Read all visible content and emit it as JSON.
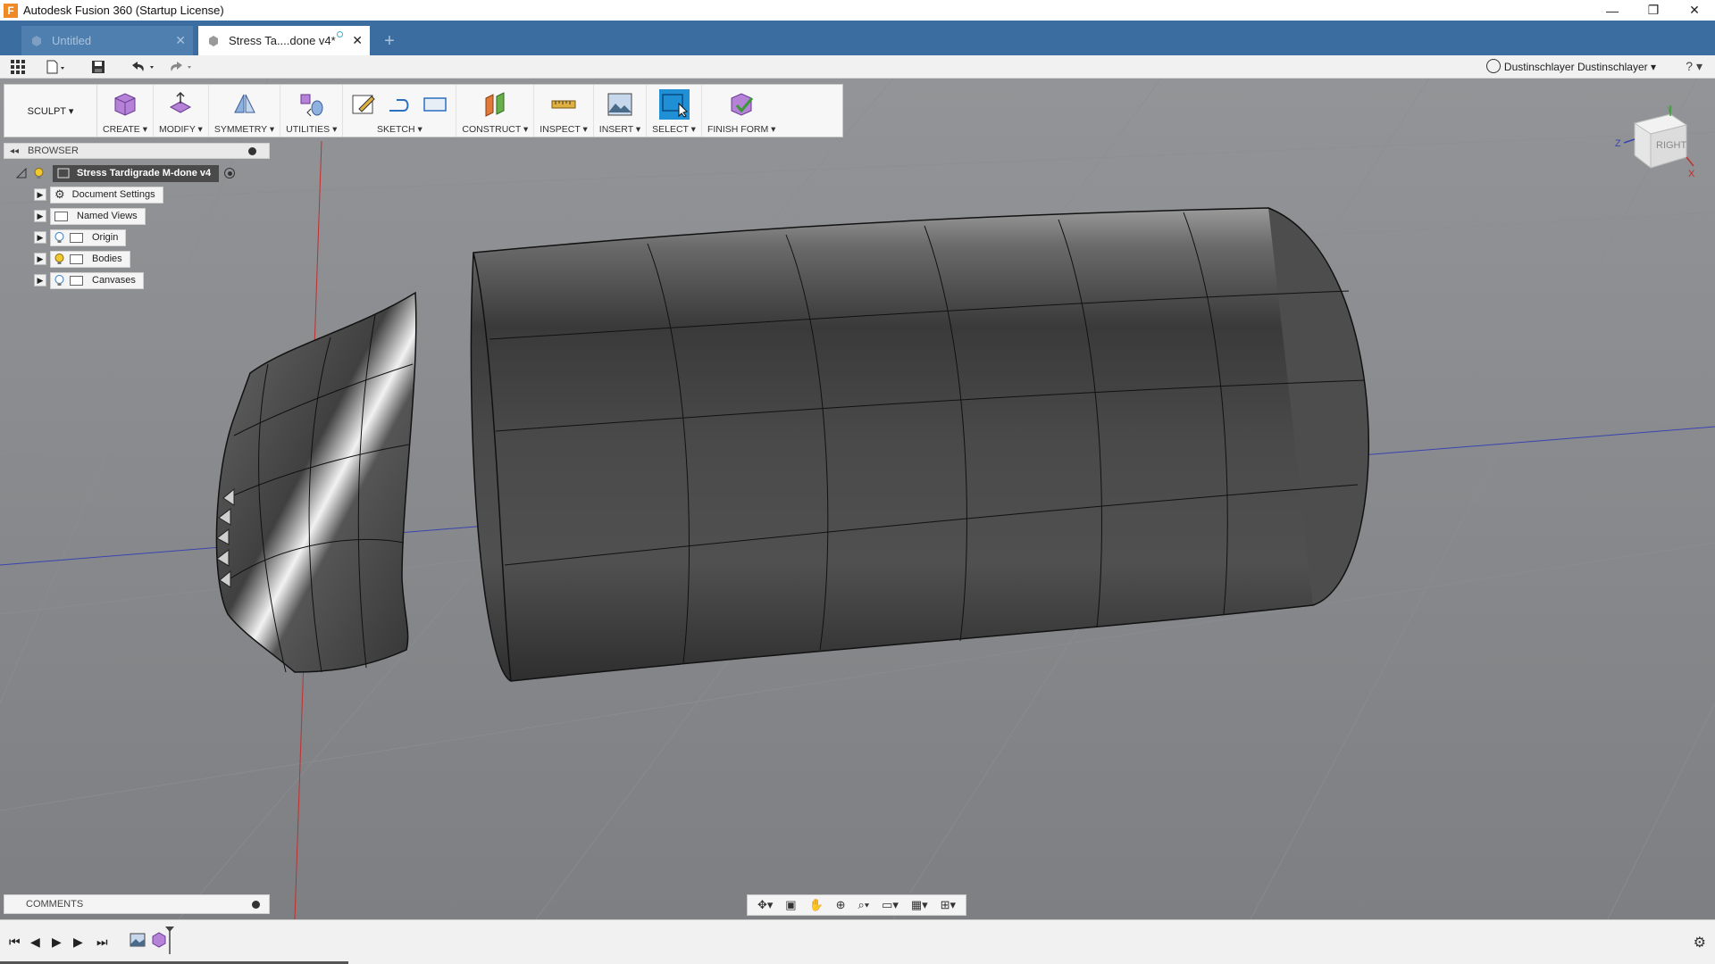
{
  "window": {
    "title": "Autodesk Fusion 360 (Startup License)",
    "app_icon": "F",
    "minimize": "—",
    "maximize": "❐",
    "close": "✕"
  },
  "tabs": [
    {
      "label": "Untitled",
      "active": false,
      "close": "✕"
    },
    {
      "label": "Stress Ta....done v4*",
      "active": true,
      "close": "✕"
    }
  ],
  "new_tab": "+",
  "qab": {
    "user": "Dustinschlayer Dustinschlayer ▾",
    "help": "? ▾"
  },
  "toolbar": {
    "workspace": "SCULPT ▾",
    "groups": {
      "create": "CREATE ▾",
      "modify": "MODIFY ▾",
      "symmetry": "SYMMETRY ▾",
      "utilities": "UTILITIES ▾",
      "sketch": "SKETCH ▾",
      "construct": "CONSTRUCT ▾",
      "inspect": "INSPECT ▾",
      "insert": "INSERT ▾",
      "select": "SELECT ▾",
      "finish_form": "FINISH FORM ▾"
    }
  },
  "browser": {
    "header": "BROWSER",
    "collapse": "◂◂",
    "root": "Stress Tardigrade M-done v4",
    "items": [
      {
        "label": "Document Settings"
      },
      {
        "label": "Named Views"
      },
      {
        "label": "Origin"
      },
      {
        "label": "Bodies"
      },
      {
        "label": "Canvases"
      }
    ]
  },
  "comments": "COMMENTS",
  "viewcube": {
    "face": "RIGHT",
    "z": "Z",
    "x": "X",
    "y": "Y"
  },
  "colors": {
    "tabbar": "#3c6da0",
    "select_highlight": "#1f8fd6",
    "viewport_top": "#929497",
    "viewport_bottom": "#7d7f82"
  }
}
